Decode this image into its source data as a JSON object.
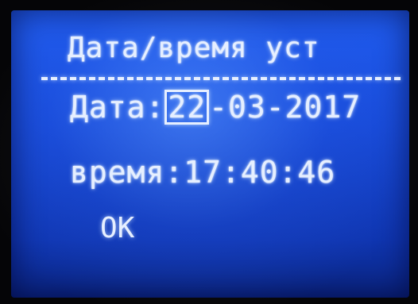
{
  "screen": {
    "title": "Дата/время уст",
    "date": {
      "label": "Дата:",
      "day": "22",
      "rest": "-03-2017"
    },
    "time": {
      "label": "время:",
      "value": "17:40:46"
    },
    "ok_label": "OK"
  },
  "colors": {
    "background": "#1f5cf0",
    "text": "#e6efff"
  }
}
